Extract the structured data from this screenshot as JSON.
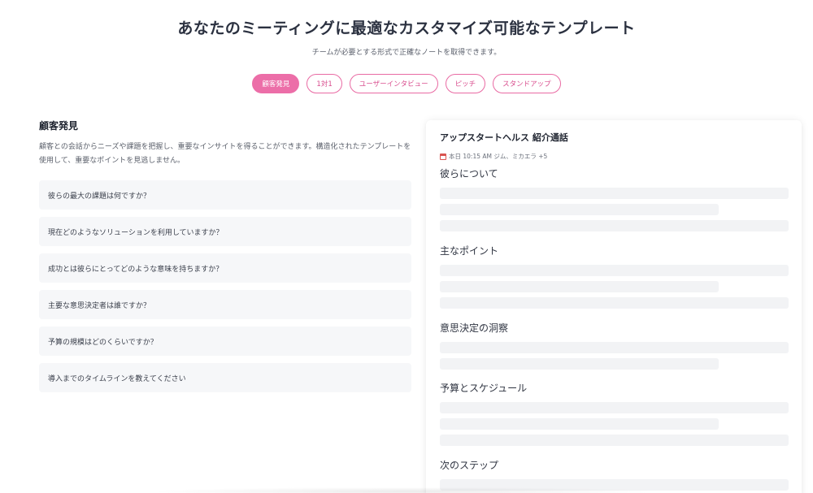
{
  "hero": {
    "title": "あなたのミーティングに最適なカスタマイズ可能なテンプレート",
    "subtitle": "チームが必要とする形式で正確なノートを取得できます。"
  },
  "tabs": [
    {
      "label": "顧客発見",
      "active": true
    },
    {
      "label": "1対1",
      "active": false
    },
    {
      "label": "ユーザーインタビュー",
      "active": false
    },
    {
      "label": "ピッチ",
      "active": false
    },
    {
      "label": "スタンドアップ",
      "active": false
    }
  ],
  "left": {
    "title": "顧客発見",
    "description": "顧客との会話からニーズや課題を把握し、重要なインサイトを得ることができます。構造化されたテンプレートを使用して、重要なポイントを見逃しません。",
    "questions": [
      "彼らの最大の課題は何ですか？",
      "現在どのようなソリューションを利用していますか？",
      "成功とは彼らにとってどのような意味を持ちますか？",
      "主要な意思決定者は誰ですか？",
      "予算の規模はどのくらいですか？",
      "導入までのタイムラインを教えてください"
    ]
  },
  "card": {
    "title": "アップスタートヘルス 紹介通話",
    "meta": "本日 10:15 AM ジム、ミカエラ +5",
    "calendar_icon": "calendar-icon",
    "sections": [
      "彼らについて",
      "主なポイント",
      "意思決定の洞察",
      "予算とスケジュール",
      "次のステップ"
    ]
  },
  "colors": {
    "accent": "#ec6ea8",
    "accent_text": "#d94f8f",
    "question_bg": "#f6f7f9",
    "placeholder_bar": "#f2f3f5"
  }
}
